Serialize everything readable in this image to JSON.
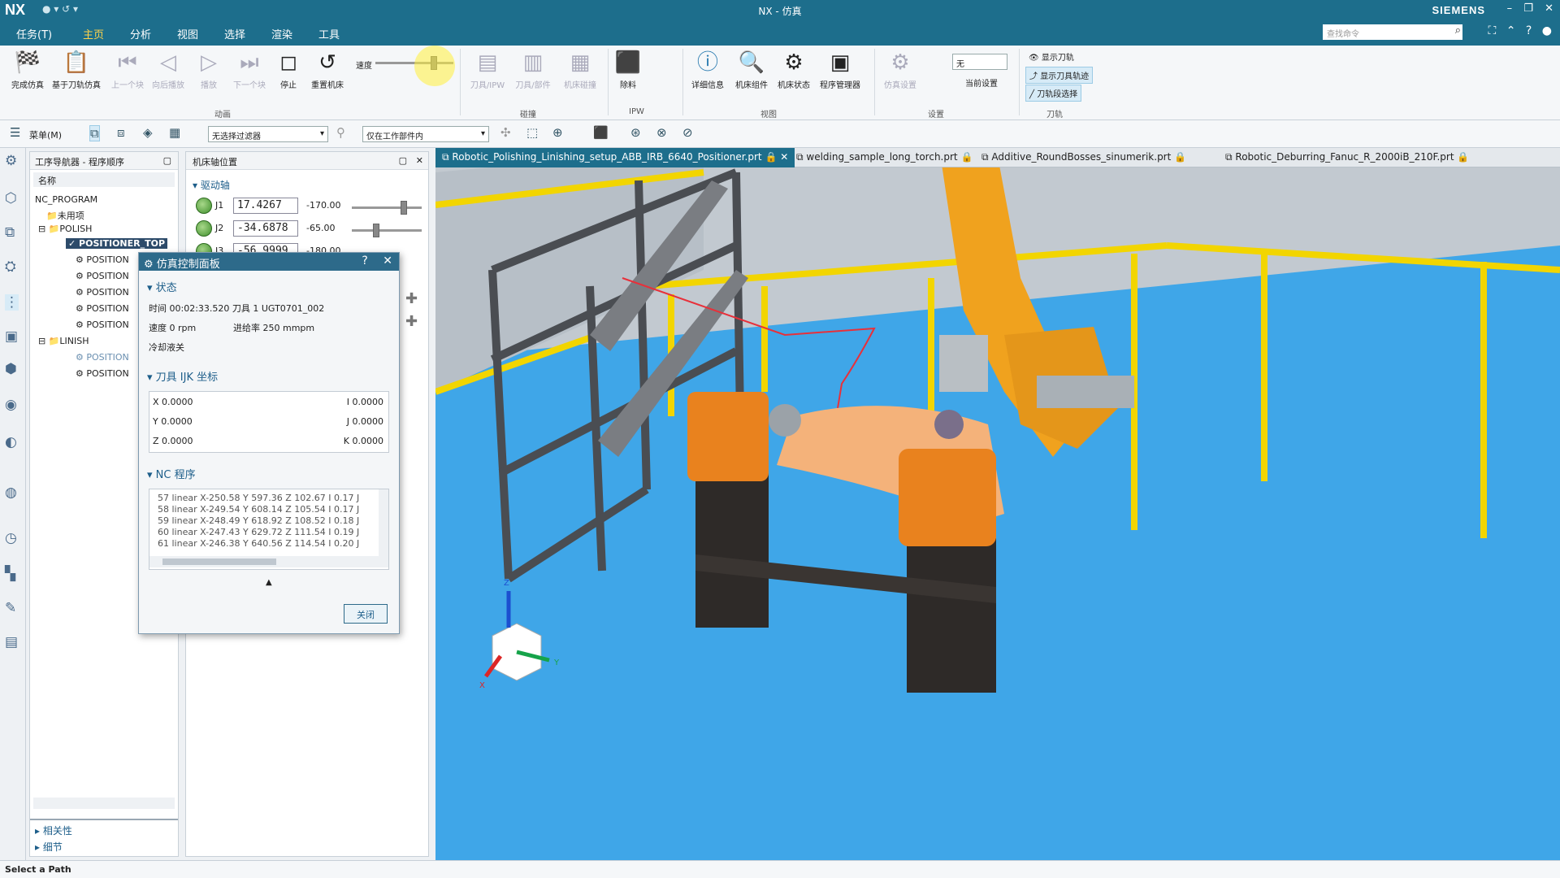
{
  "window": {
    "logo": "NX",
    "title": "NX - 仿真",
    "brand": "SIEMENS",
    "controls": [
      "–",
      "❐",
      "✕"
    ]
  },
  "menu": {
    "items": [
      "任务(T)",
      "主页",
      "分析",
      "视图",
      "选择",
      "渲染",
      "工具"
    ],
    "search_placeholder": "查找命令"
  },
  "ribbon": {
    "speed_label": "速度",
    "animation": [
      "完成仿真",
      "基于刀轨仿真",
      "上一个块",
      "向后播放",
      "播放",
      "下一个块",
      "停止",
      "重置机床"
    ],
    "animation_group": "动画",
    "collision": [
      "刀具/IPW",
      "刀具/部件",
      "机床碰撞"
    ],
    "collision_group": "碰撞",
    "ipw": [
      "除料"
    ],
    "ipw_group": "IPW",
    "view": [
      "详细信息",
      "机床组件",
      "机床状态",
      "程序管理器"
    ],
    "view_group": "视图",
    "settings": [
      "仿真设置",
      "当前设置"
    ],
    "settings_value": "无",
    "settings_group": "设置",
    "toolpath": [
      "显示刀轨",
      "显示刀具轨迹",
      "刀轨段选择"
    ],
    "toolpath_group": "刀轨"
  },
  "toolbar2": {
    "menu_label": "菜单(M)",
    "filter_value": "无选择过滤器",
    "scope_value": "仅在工作部件内"
  },
  "navigator": {
    "title": "工序导航器 - 程序顺序",
    "col_name": "名称",
    "root": "NC_PROGRAM",
    "unused": "未用项",
    "groups": [
      {
        "name": "POLISH",
        "ops": [
          "POSITIONER_TOP",
          "POSITION",
          "POSITION",
          "POSITION",
          "POSITION",
          "POSITION"
        ]
      },
      {
        "name": "LINISH",
        "ops": [
          "POSITION",
          "POSITION"
        ]
      }
    ],
    "footer": [
      "相关性",
      "细节"
    ]
  },
  "axis_panel": {
    "title": "机床轴位置",
    "section": "驱动轴",
    "joints": [
      {
        "name": "J1",
        "value": "17.4267",
        "limit": "-170.00",
        "level": 0.7
      },
      {
        "name": "J2",
        "value": "-34.6878",
        "limit": "-65.00",
        "level": 0.3
      },
      {
        "name": "J3",
        "value": "-56.9999",
        "limit": "-180.00",
        "level": 0.5
      }
    ]
  },
  "dialog": {
    "title": "仿真控制面板",
    "status_section": "状态",
    "time_line": "时间 00:02:33.520 刀具 1   UGT0701_002",
    "speed_label": "速度 0 rpm",
    "feed_label": "进给率 250 mmpm",
    "coolant": "冷却液关",
    "ijk_section": "刀具 IJK 坐标",
    "ijk": {
      "x": "X 0.0000",
      "y": "Y 0.0000",
      "z": "Z 0.0000",
      "i": "I 0.0000",
      "j": "J 0.0000",
      "k": "K 0.0000"
    },
    "nc_section": "NC 程序",
    "nc_lines": [
      "57 linear X-250.58 Y 597.36 Z 102.67 I   0.17 J",
      "58 linear X-249.54 Y 608.14 Z 105.54 I   0.17 J",
      "59 linear X-248.49 Y 618.92 Z 108.52 I   0.18 J",
      "60 linear X-247.43 Y 629.72 Z 111.54 I   0.19 J",
      "61 linear X-246.38 Y 640.56 Z 114.54 I   0.20 J"
    ],
    "close_label": "关闭"
  },
  "tabs": [
    "Robotic_Polishing_Linishing_setup_ABB_IRB_6640_Positioner.prt",
    "welding_sample_long_torch.prt",
    "Additive_RoundBosses_sinumerik.prt",
    "Robotic_Deburring_Fanuc_R_2000iB_210F.prt"
  ],
  "triad": {
    "x": "X",
    "y": "Y",
    "z": "Z"
  },
  "statusbar": {
    "text": "Select a Path"
  },
  "colors": {
    "accent": "#1d6e8c",
    "floor": "#3a9fe0",
    "robot": "#f0a21e",
    "fence": "#f2d500"
  }
}
